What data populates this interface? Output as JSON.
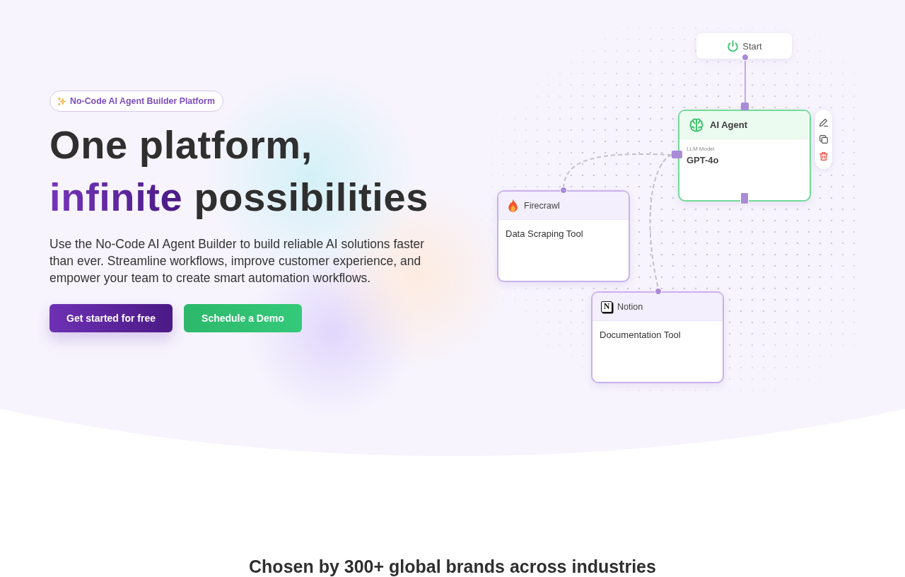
{
  "badge": {
    "text": "No-Code AI Agent Builder Platform"
  },
  "heading": {
    "line_1": "One platform,",
    "highlight": "infinite",
    "line_2_rest": "possibilities"
  },
  "description": "Use the No-Code AI Agent Builder to build reliable AI solutions faster than ever. Streamline workflows, improve customer experience, and empower your team to create smart automation workflows.",
  "buttons": [
    {
      "label": "Get started for free",
      "kind": "primary"
    },
    {
      "label": "Schedule a Demo",
      "kind": "secondary"
    }
  ],
  "workflow": {
    "start_node": {
      "label": "Start"
    },
    "agent_node": {
      "title": "AI Agent",
      "field_label": "LLM Model",
      "field_value": "GPT-4o",
      "selected": true
    },
    "tool_nodes": [
      {
        "title": "Firecrawl",
        "description": "Data Scraping Tool",
        "kind": "flame",
        "selected": false
      },
      {
        "title": "Notion",
        "description": "Documentation Tool",
        "kind": "tile",
        "logo_letter": "N",
        "selected": false
      }
    ]
  },
  "section_heading": "Chosen by 300+ global brands across industries"
}
